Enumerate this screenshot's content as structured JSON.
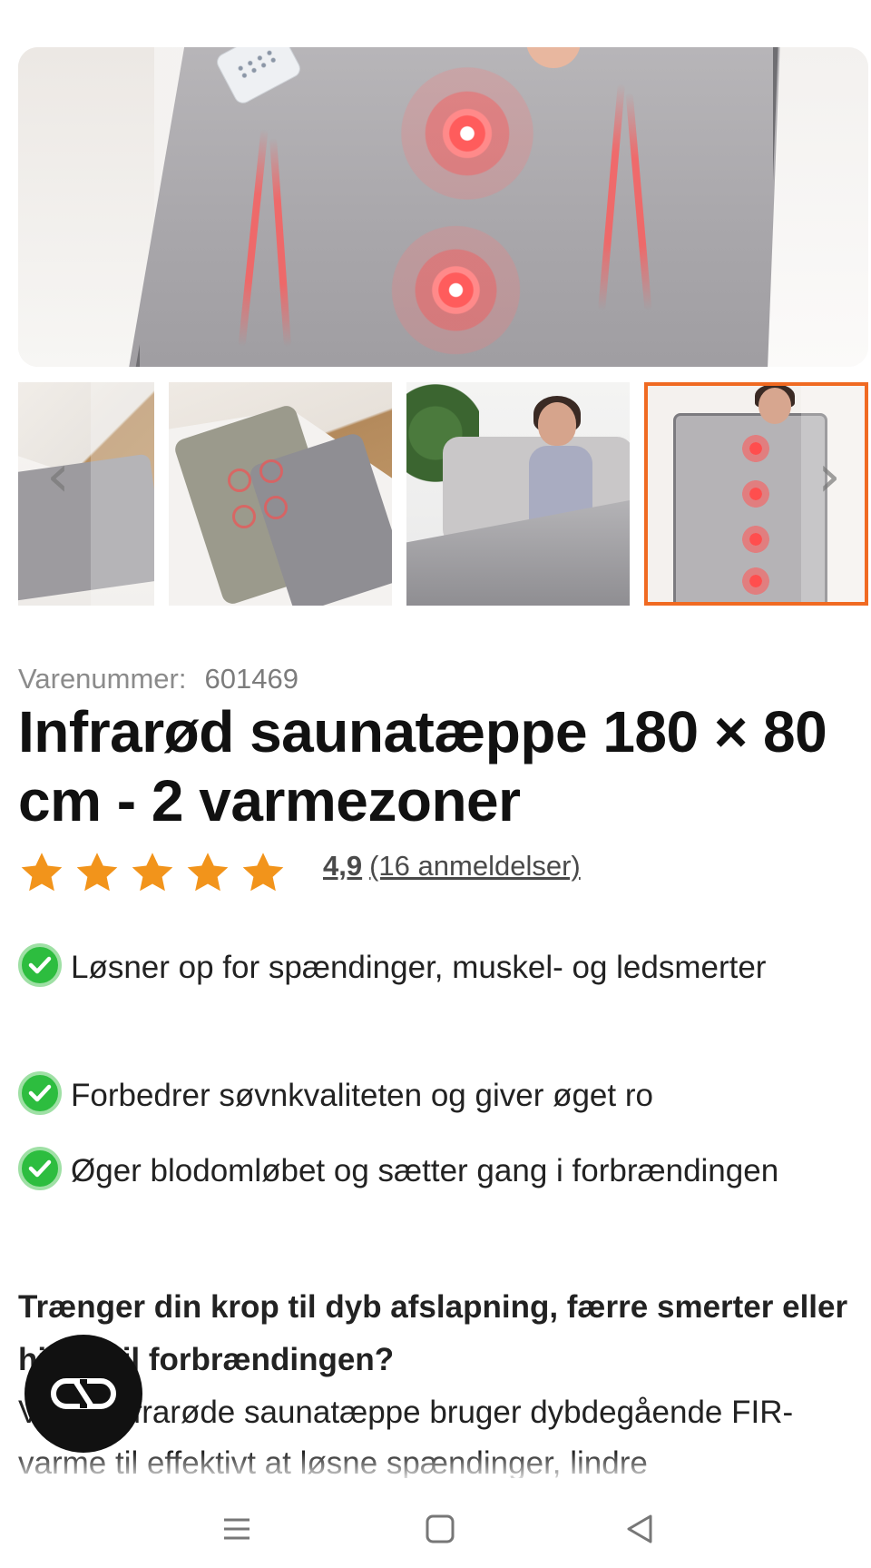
{
  "product": {
    "sku_label": "Varenummer:",
    "sku_value": "601469",
    "title": "Infrarød saunatæppe 180 × 80 cm - 2 varmezoner",
    "rating_score": "4,9",
    "rating_count": "(16 anmeldelser)",
    "stars": 5
  },
  "benefits": [
    "Løsner op for spændinger, muskel- og ledsmerter",
    "Forbedrer søvnkvaliteten og giver øget ro",
    "Øger blodomløbet og sætter gang i forbrændingen"
  ],
  "description": {
    "question": "Trænger din krop til dyb afslapning, færre smerter eller hjælp til forbrændingen?",
    "body": "Vores infrarøde saunatæppe bruger dybdegående FIR-varme til effektivt at løsne spændinger, lindre"
  },
  "gallery": {
    "prev_icon": "chevron-left-icon",
    "next_icon": "chevron-right-icon",
    "thumbnail_count": 4,
    "selected_index": 3
  },
  "colors": {
    "accent": "#f06a22",
    "star": "#f2941b",
    "check": "#2dbd3f"
  },
  "system_nav": [
    "menu-icon",
    "home-icon",
    "back-icon"
  ]
}
